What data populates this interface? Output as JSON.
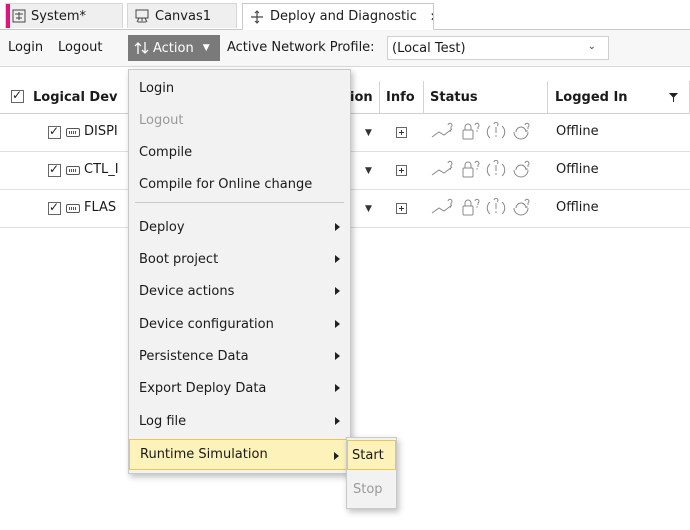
{
  "tabs": [
    {
      "label": "System*"
    },
    {
      "label": "Canvas1"
    },
    {
      "label": "Deploy and Diagnostic"
    }
  ],
  "tab_close": "✕",
  "toolbar": {
    "login": "Login",
    "logout": "Logout",
    "action": "Action",
    "profile_label": "Active Network Profile:",
    "profile_value": "(Local Test)"
  },
  "table": {
    "headers": [
      "Logical Dev",
      "ion",
      "Info",
      "Status",
      "Logged In"
    ],
    "rows": [
      {
        "name": "DISPI",
        "logged_in": "Offline"
      },
      {
        "name": "CTL_I",
        "logged_in": "Offline"
      },
      {
        "name": "FLAS",
        "logged_in": "Offline"
      }
    ]
  },
  "action_menu": {
    "items": [
      {
        "label": "Login",
        "disabled": false
      },
      {
        "label": "Logout",
        "disabled": true
      },
      {
        "label": "Compile",
        "disabled": false
      },
      {
        "label": "Compile for Online change",
        "disabled": false
      },
      {
        "label": "Deploy",
        "submenu": true
      },
      {
        "label": "Boot project",
        "submenu": true
      },
      {
        "label": "Device actions",
        "submenu": true
      },
      {
        "label": "Device configuration",
        "submenu": true
      },
      {
        "label": "Persistence Data",
        "submenu": true
      },
      {
        "label": "Export Deploy Data",
        "submenu": true
      },
      {
        "label": "Log file",
        "submenu": true
      },
      {
        "label": "Runtime Simulation",
        "submenu": true,
        "highlighted": true
      }
    ]
  },
  "submenu": {
    "items": [
      {
        "label": "Start",
        "highlighted": true
      },
      {
        "label": "Stop",
        "disabled": true
      }
    ]
  },
  "colors": {
    "accent": "#e0147b",
    "highlight": "#fdf2b9",
    "action_button": "#7a7a7a"
  }
}
